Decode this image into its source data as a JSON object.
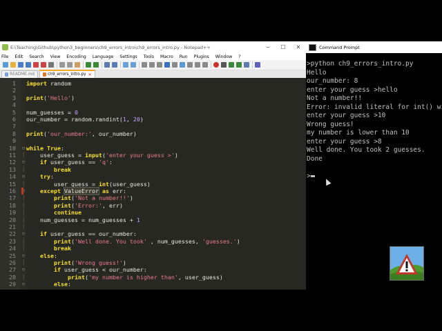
{
  "notepad": {
    "title": "E:\\Teaching\\Github\\python3_beginners\\ch9_errors_intro\\ch9_errors_intro.py - Notepad++",
    "window_buttons": [
      "─",
      "☐",
      "✕"
    ],
    "menu": [
      "File",
      "Edit",
      "Search",
      "View",
      "Encoding",
      "Language",
      "Settings",
      "Tools",
      "Macro",
      "Run",
      "Plugins",
      "Window",
      "?"
    ],
    "tabs": [
      {
        "label": "README.md",
        "active": false
      },
      {
        "label": "ch9_errors_intro.py",
        "active": true
      }
    ],
    "lines": [
      {
        "n": "1",
        "code": "import random"
      },
      {
        "n": "2",
        "code": ""
      },
      {
        "n": "3",
        "code": "print('Hello')"
      },
      {
        "n": "4",
        "code": ""
      },
      {
        "n": "5",
        "code": "num_guesses = 0"
      },
      {
        "n": "6",
        "code": "our_number = random.randint(1, 20)"
      },
      {
        "n": "7",
        "code": ""
      },
      {
        "n": "8",
        "code": "print('our_number:', our_number)"
      },
      {
        "n": "9",
        "code": ""
      },
      {
        "n": "10",
        "code": "while True:"
      },
      {
        "n": "11",
        "code": "    user_guess = input('enter your guess >')"
      },
      {
        "n": "12",
        "code": "    if user_guess == 'q':"
      },
      {
        "n": "13",
        "code": "        break"
      },
      {
        "n": "14",
        "code": "    try:"
      },
      {
        "n": "15",
        "code": "        user_guess = int(user_guess)"
      },
      {
        "n": "16",
        "code": "    except ValueError as err:"
      },
      {
        "n": "17",
        "code": "        print('Not a number!!')"
      },
      {
        "n": "18",
        "code": "        print('Error:', err)"
      },
      {
        "n": "19",
        "code": "        continue"
      },
      {
        "n": "20",
        "code": "    num_guesses = num_guesses + 1"
      },
      {
        "n": "21",
        "code": ""
      },
      {
        "n": "22",
        "code": "    if user_guess == our_number:"
      },
      {
        "n": "23",
        "code": "        print('Well done. You took' , num_guesses, 'guesses.')"
      },
      {
        "n": "24",
        "code": "        break"
      },
      {
        "n": "25",
        "code": "    else:"
      },
      {
        "n": "26",
        "code": "        print('Wrong guess!')"
      },
      {
        "n": "27",
        "code": "        if user_guess < our_number:"
      },
      {
        "n": "28",
        "code": "            print('my number is higher than', user_guess)"
      },
      {
        "n": "29",
        "code": "        else:"
      }
    ]
  },
  "cmd": {
    "title": "Command Prompt",
    "lines": [
      ">python ch9_errors_intro.py",
      "Hello",
      "our_number: 8",
      "enter your guess >hello",
      "Not a number!!",
      "Error: invalid literal for int() wi",
      "enter your guess >10",
      "Wrong guess!",
      "my number is lower than 10",
      "enter your guess >8",
      "Well done. You took 2 guesses.",
      "Done",
      "",
      ">"
    ]
  },
  "colors": {
    "editor_bg": "#272822",
    "keyword": "#f9e02a",
    "string": "#f07a8f",
    "number": "#c6a3ff",
    "cmd_text": "#c0c0c0"
  },
  "logo_icon": "warning-triangle-logo"
}
